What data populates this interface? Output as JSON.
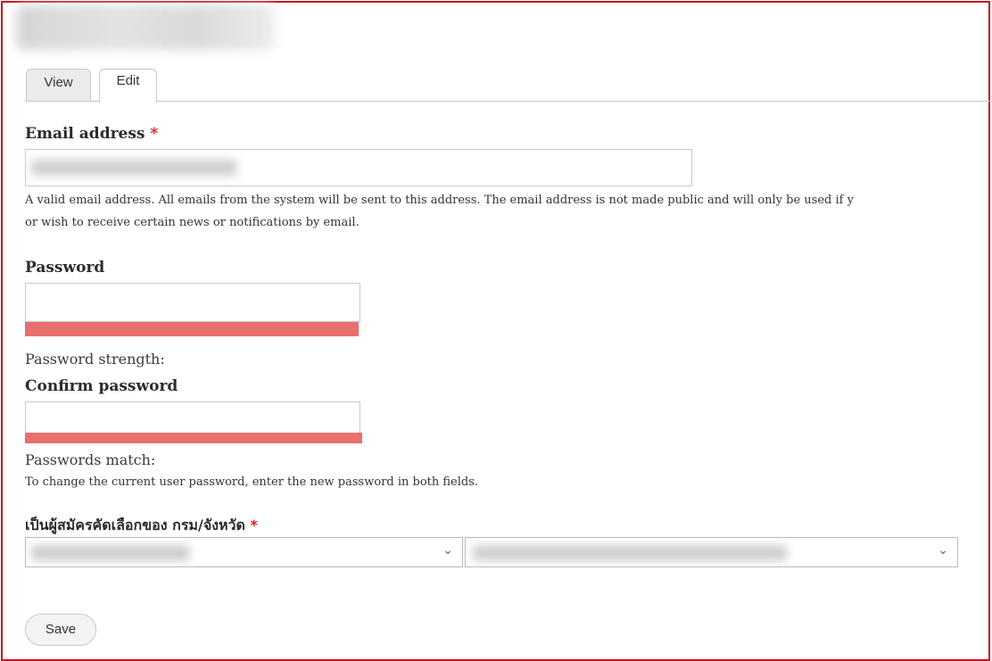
{
  "tabs": {
    "view": "View",
    "edit": "Edit"
  },
  "email": {
    "label": "Email address",
    "required_marker": "*",
    "value": "",
    "description_line1": "A valid email address. All emails from the system will be sent to this address. The email address is not made public and will only be used if y",
    "description_line2": "or wish to receive certain news or notifications by email."
  },
  "password": {
    "label": "Password",
    "strength_label": "Password strength:",
    "strength_bar_color": "#e96e6e"
  },
  "confirm_password": {
    "label": "Confirm password",
    "match_label": "Passwords match:",
    "help": "To change the current user password, enter the new password in both fields."
  },
  "selector": {
    "label": "เป็นผู้สมัครคัดเลือกของ กรม/จังหวัด",
    "required_marker": "*"
  },
  "actions": {
    "save": "Save"
  },
  "colors": {
    "frame_border": "#c4161c",
    "required": "#d21f1f",
    "bar": "#e96e6e"
  }
}
